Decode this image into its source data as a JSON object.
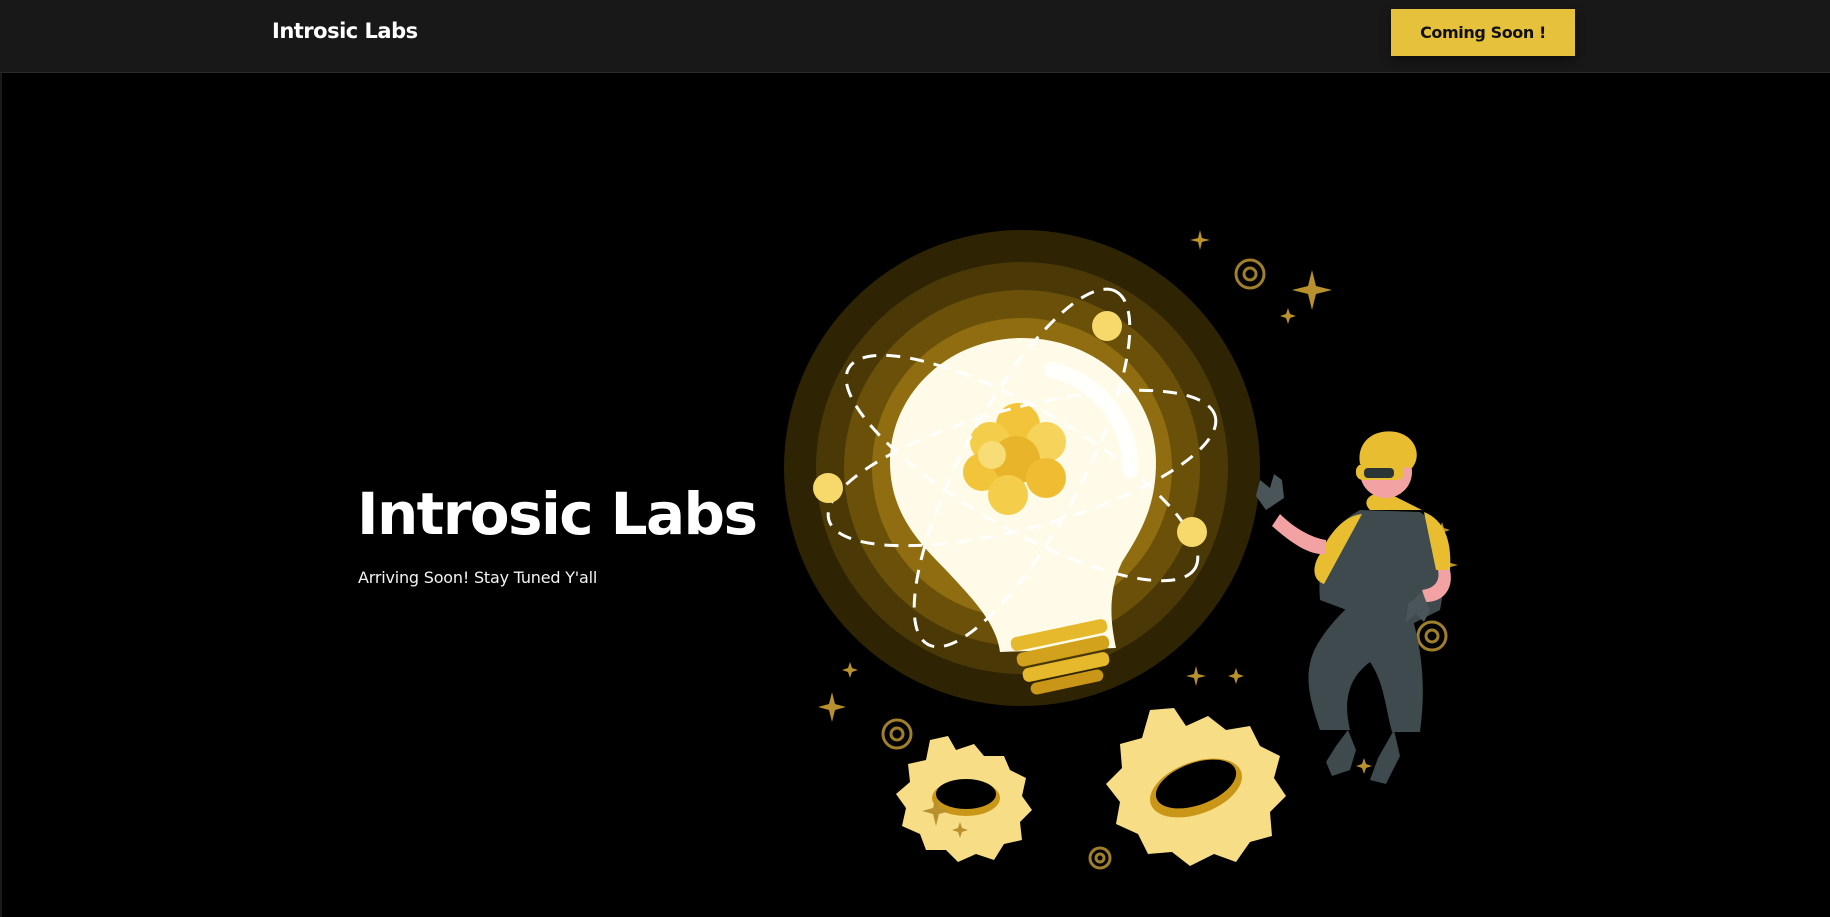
{
  "navbar": {
    "brand": "Introsic Labs",
    "cta_label": "Coming Soon !"
  },
  "hero": {
    "title": "Introsic Labs",
    "subtitle": "Arriving Soon! Stay Tuned Y'all"
  },
  "illustration": {
    "name": "lightbulb-idea-illustration",
    "colors": {
      "accent": "#e6c13c",
      "glow_outer": "#2e2403",
      "bulb": "#fffbe8",
      "gear": "#f7dd86"
    }
  }
}
